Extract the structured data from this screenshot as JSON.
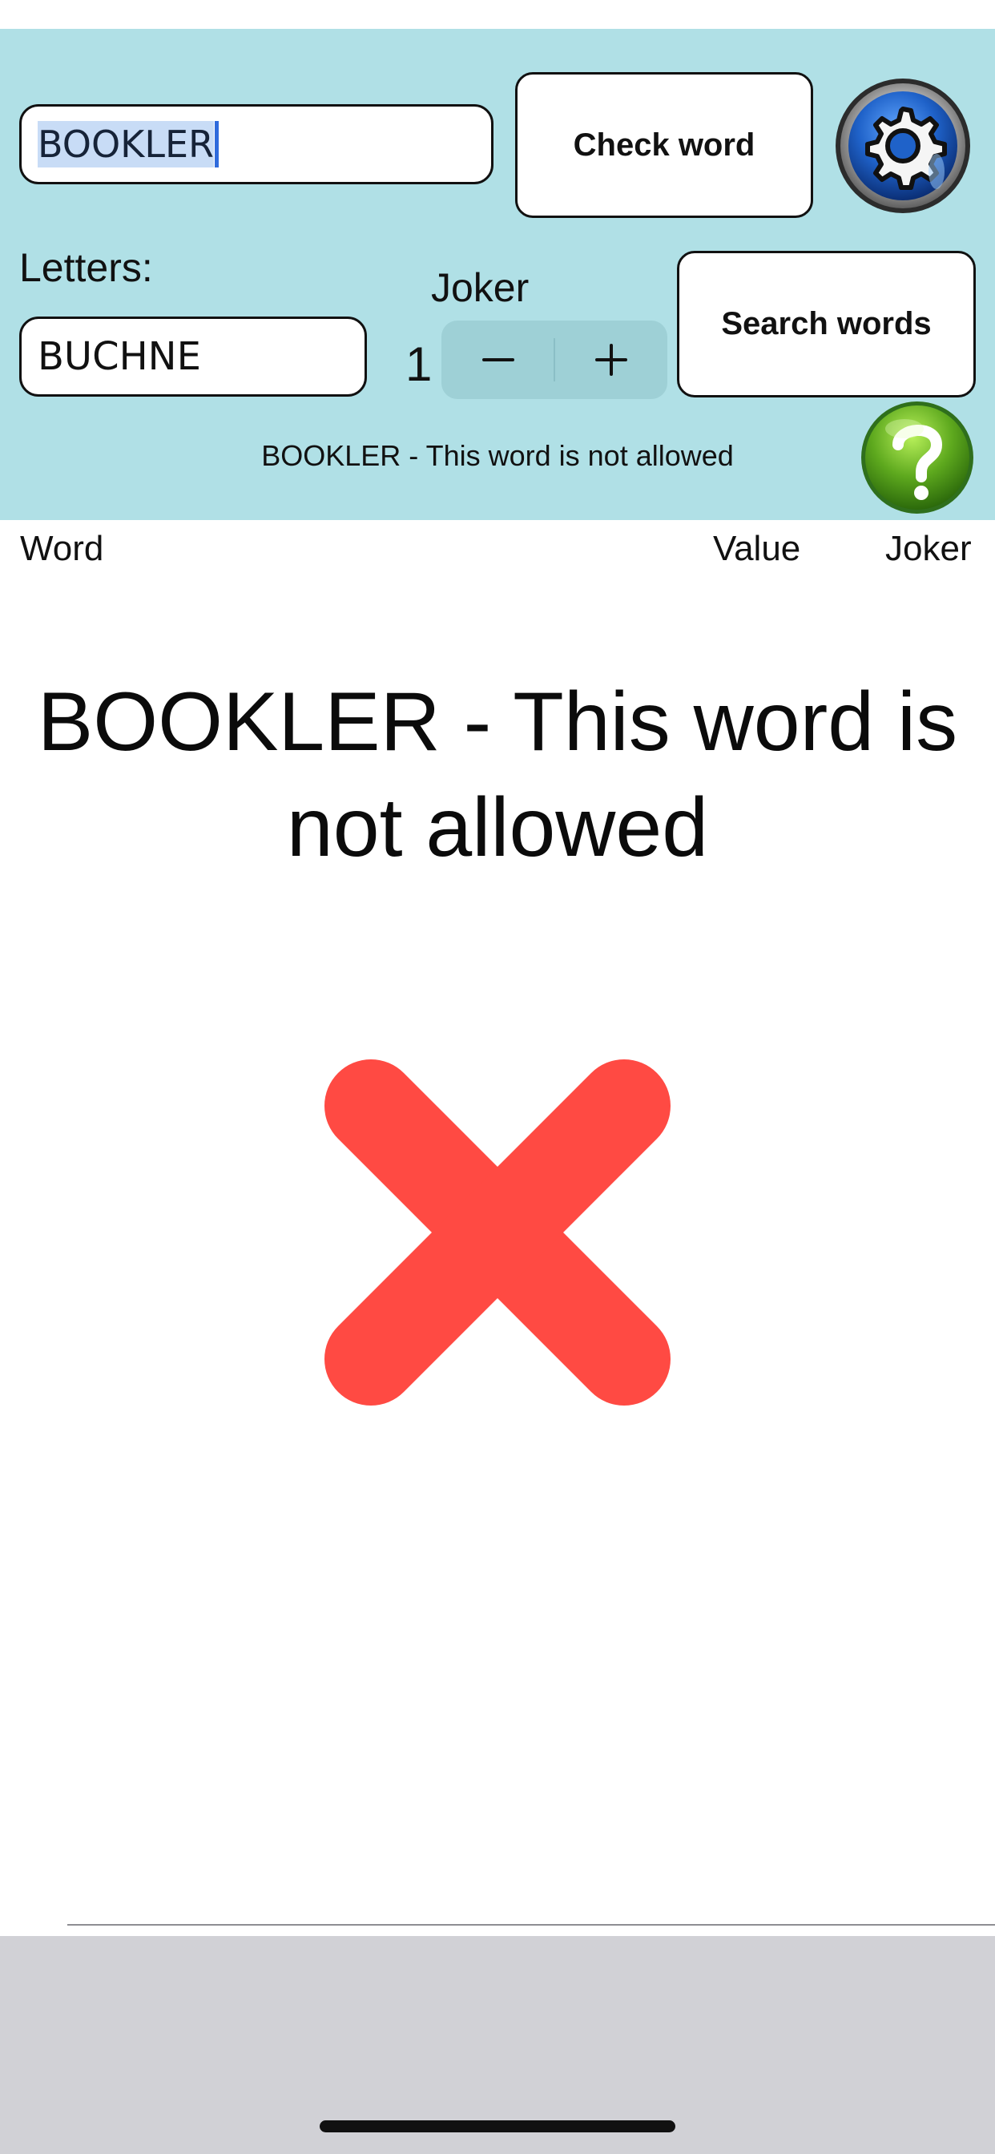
{
  "input": {
    "word_value": "BOOKLER",
    "letters_label": "Letters:",
    "letters_value": "BUCHNE"
  },
  "buttons": {
    "check_word": "Check word",
    "search_words": "Search words",
    "settings_icon": "gear-icon",
    "help_icon": "question-mark-icon"
  },
  "joker": {
    "label": "Joker",
    "count": "1",
    "minus": "−",
    "plus": "+"
  },
  "status": {
    "message": "BOOKLER - This word is not allowed"
  },
  "table": {
    "headers": [
      "Word",
      "Value",
      "Joker"
    ]
  },
  "result": {
    "message": "BOOKLER - This word is not allowed",
    "icon": "red-x-icon"
  },
  "colors": {
    "header_background": "#b0e0e6",
    "result_icon_color": "#ff4a43",
    "bottom_bar": "#d1d1d6"
  }
}
